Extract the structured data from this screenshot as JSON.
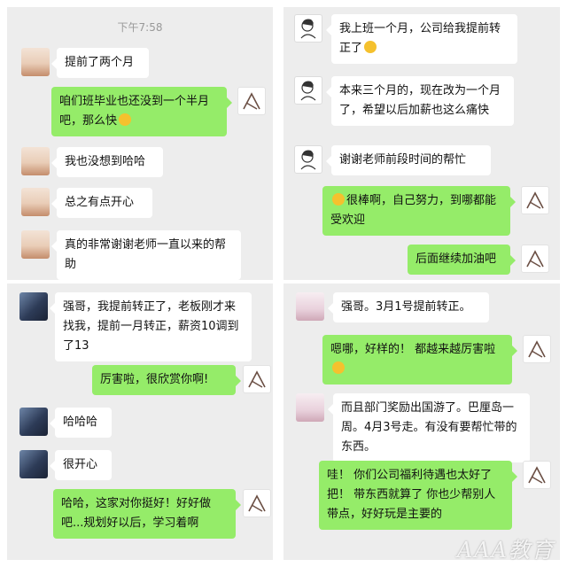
{
  "panel1": {
    "time": "下午7:58",
    "messages": [
      {
        "side": "in",
        "text": "提前了两个月"
      },
      {
        "side": "out",
        "text": "咱们班毕业也还没到一个半月吧，那么快"
      },
      {
        "side": "in",
        "text": "我也没想到哈哈"
      },
      {
        "side": "in",
        "text": "总之有点开心"
      },
      {
        "side": "in",
        "text": "真的非常谢谢老师一直以来的帮助"
      }
    ]
  },
  "panel2": {
    "messages": [
      {
        "side": "in",
        "text": "我上班一个月，公司给我提前转正了"
      },
      {
        "side": "in",
        "text": "本来三个月的，现在改为一个月了，希望以后加薪也这么痛快"
      },
      {
        "side": "in",
        "text": "谢谢老师前段时间的帮忙"
      },
      {
        "side": "out",
        "text": "很棒啊，自己努力，到哪都能受欢迎"
      },
      {
        "side": "out",
        "text": "后面继续加油吧"
      }
    ]
  },
  "panel3": {
    "messages": [
      {
        "side": "in",
        "text": "强哥，我提前转正了，老板刚才来找我，提前一月转正，薪资10调到了13"
      },
      {
        "side": "out",
        "text": "厉害啦，很欣赏你啊!"
      },
      {
        "side": "in",
        "text": "哈哈哈"
      },
      {
        "side": "in",
        "text": "很开心"
      },
      {
        "side": "out",
        "text": "哈哈，这家对你挺好！好好做吧...规划好以后，学习着啊"
      }
    ]
  },
  "panel4": {
    "messages": [
      {
        "side": "in",
        "text": "强哥。3月1号提前转正。"
      },
      {
        "side": "out",
        "text": "嗯哪，好样的！ 都越来越厉害啦"
      },
      {
        "side": "in",
        "text": "而且部门奖励出国游了。巴厘岛一周。4月3号走。有没有要帮忙带的东西。"
      },
      {
        "side": "out",
        "text": "哇！ 你们公司福利待遇也太好了把！ 带东西就算了 你也少帮别人带点，好好玩是主要的"
      }
    ]
  },
  "watermark": "AAA教育",
  "colors": {
    "out_bubble": "#95ec69",
    "in_bubble": "#ffffff",
    "chat_bg": "#ededed"
  }
}
